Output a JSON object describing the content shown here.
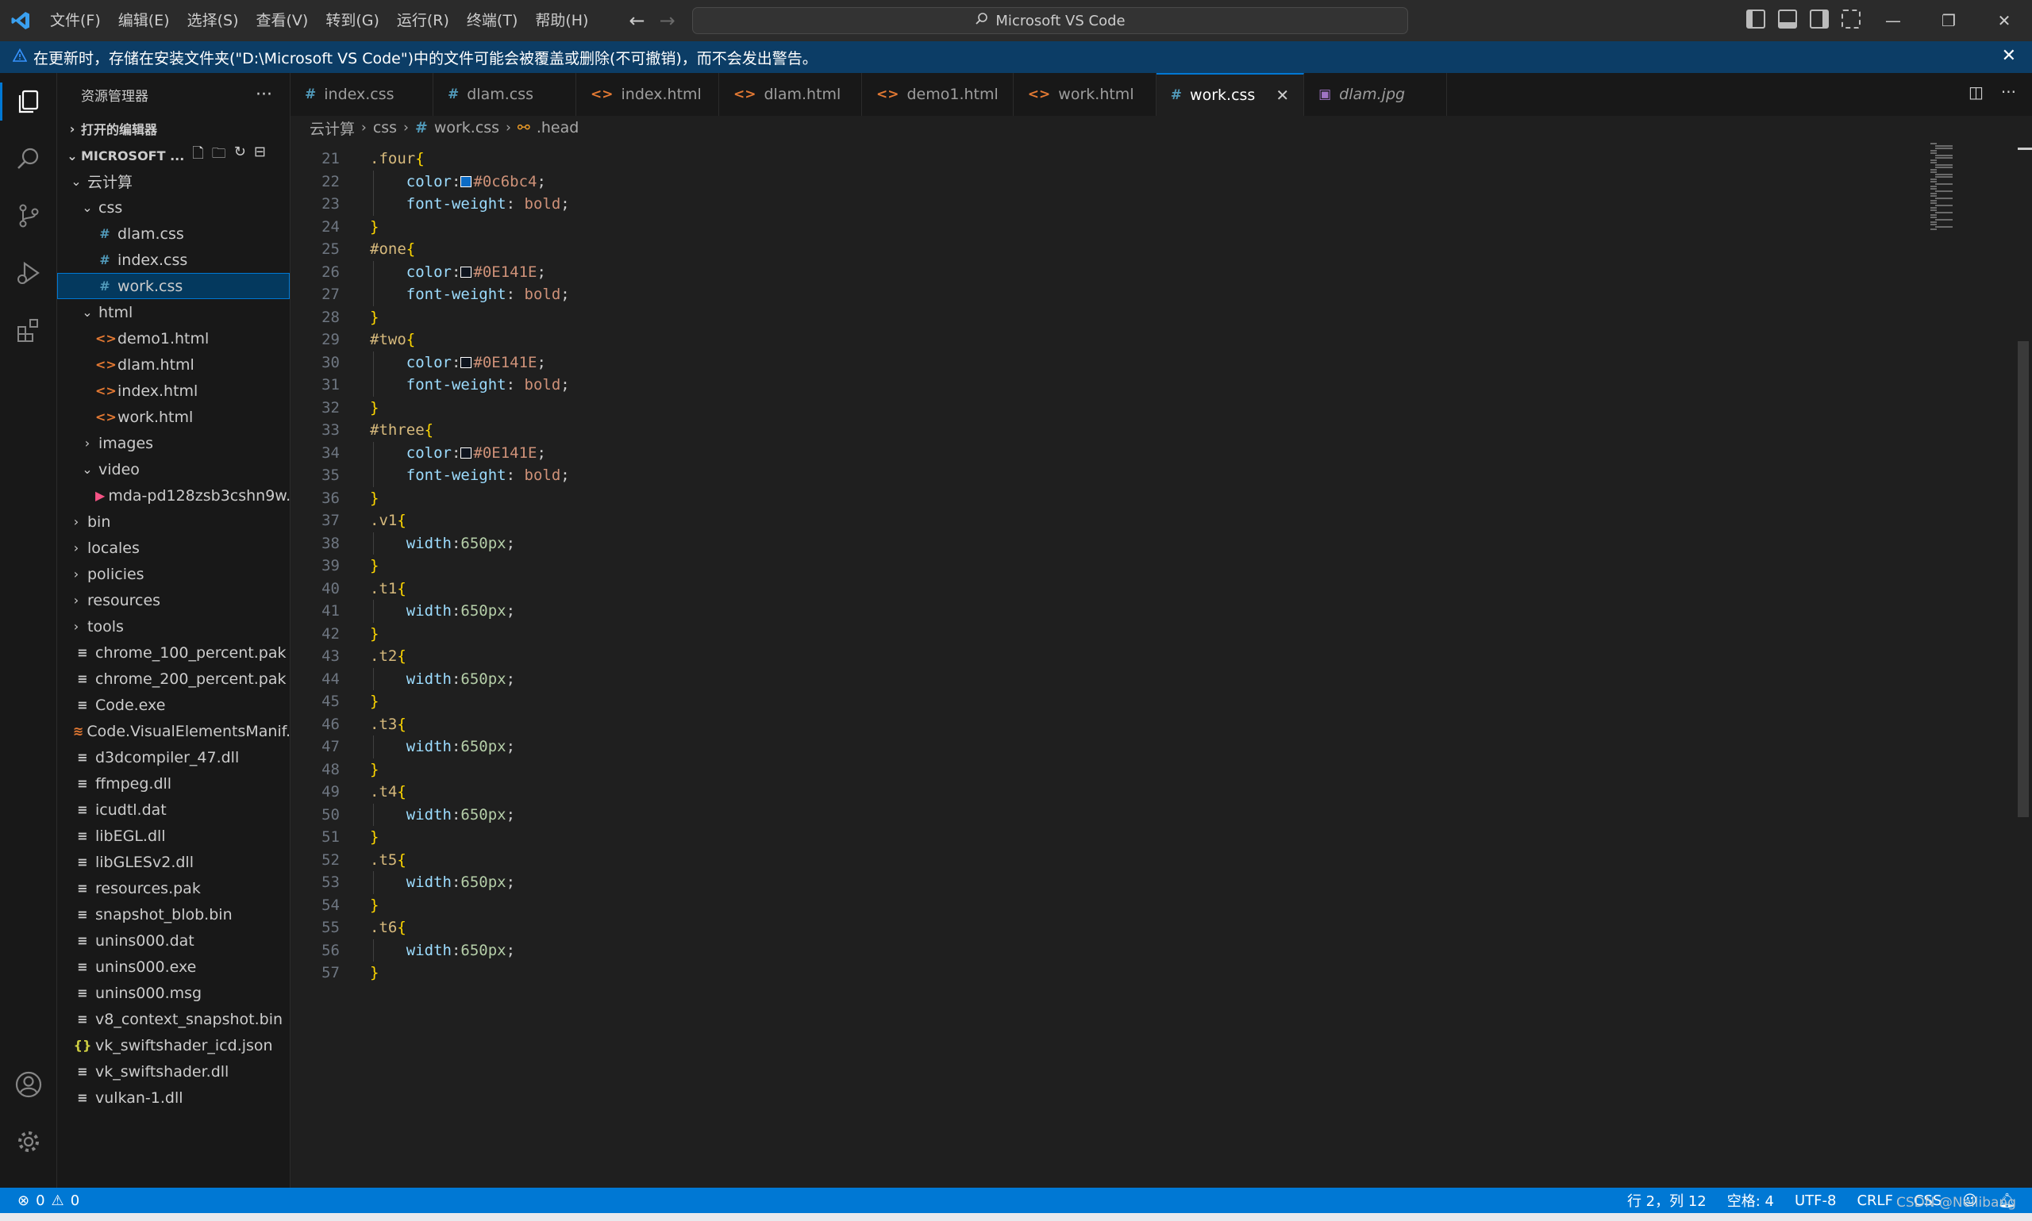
{
  "titlebar": {
    "menu": [
      "文件(F)",
      "编辑(E)",
      "选择(S)",
      "查看(V)",
      "转到(G)",
      "运行(R)",
      "终端(T)",
      "帮助(H)"
    ],
    "search_text": "Microsoft VS Code"
  },
  "banner": {
    "text": "在更新时，存储在安装文件夹(\"D:\\Microsoft VS Code\")中的文件可能会被覆盖或删除(不可撤销)，而不会发出警告。"
  },
  "sidebar": {
    "title": "资源管理器",
    "open_editors_label": "打开的编辑器",
    "folder_label": "MICROSOFT ...",
    "tree": [
      {
        "label": "云计算",
        "type": "folder-open",
        "depth": 1
      },
      {
        "label": "css",
        "type": "folder-open",
        "depth": 2
      },
      {
        "label": "dlam.css",
        "type": "css",
        "depth": 3
      },
      {
        "label": "index.css",
        "type": "css",
        "depth": 3
      },
      {
        "label": "work.css",
        "type": "css",
        "depth": 3,
        "selected": true
      },
      {
        "label": "html",
        "type": "folder-open",
        "depth": 2
      },
      {
        "label": "demo1.html",
        "type": "html",
        "depth": 3
      },
      {
        "label": "dlam.html",
        "type": "html",
        "depth": 3
      },
      {
        "label": "index.html",
        "type": "html",
        "depth": 3
      },
      {
        "label": "work.html",
        "type": "html",
        "depth": 3
      },
      {
        "label": "images",
        "type": "folder",
        "depth": 2
      },
      {
        "label": "video",
        "type": "folder-open",
        "depth": 2
      },
      {
        "label": "mda-pd128zsb3cshn9w...",
        "type": "video",
        "depth": 3
      },
      {
        "label": "bin",
        "type": "folder",
        "depth": 1
      },
      {
        "label": "locales",
        "type": "folder",
        "depth": 1
      },
      {
        "label": "policies",
        "type": "folder",
        "depth": 1
      },
      {
        "label": "resources",
        "type": "folder",
        "depth": 1
      },
      {
        "label": "tools",
        "type": "folder",
        "depth": 1
      },
      {
        "label": "chrome_100_percent.pak",
        "type": "file",
        "depth": 1
      },
      {
        "label": "chrome_200_percent.pak",
        "type": "file",
        "depth": 1
      },
      {
        "label": "Code.exe",
        "type": "file",
        "depth": 1
      },
      {
        "label": "Code.VisualElementsManif...",
        "type": "xml",
        "depth": 1
      },
      {
        "label": "d3dcompiler_47.dll",
        "type": "file",
        "depth": 1
      },
      {
        "label": "ffmpeg.dll",
        "type": "file",
        "depth": 1
      },
      {
        "label": "icudtl.dat",
        "type": "file",
        "depth": 1
      },
      {
        "label": "libEGL.dll",
        "type": "file",
        "depth": 1
      },
      {
        "label": "libGLESv2.dll",
        "type": "file",
        "depth": 1
      },
      {
        "label": "resources.pak",
        "type": "file",
        "depth": 1
      },
      {
        "label": "snapshot_blob.bin",
        "type": "file",
        "depth": 1
      },
      {
        "label": "unins000.dat",
        "type": "file",
        "depth": 1
      },
      {
        "label": "unins000.exe",
        "type": "file",
        "depth": 1
      },
      {
        "label": "unins000.msg",
        "type": "file",
        "depth": 1
      },
      {
        "label": "v8_context_snapshot.bin",
        "type": "file",
        "depth": 1
      },
      {
        "label": "vk_swiftshader_icd.json",
        "type": "json",
        "depth": 1
      },
      {
        "label": "vk_swiftshader.dll",
        "type": "file",
        "depth": 1
      },
      {
        "label": "vulkan-1.dll",
        "type": "file",
        "depth": 1
      }
    ]
  },
  "tabs": [
    {
      "label": "index.css",
      "type": "css"
    },
    {
      "label": "dlam.css",
      "type": "css"
    },
    {
      "label": "index.html",
      "type": "html"
    },
    {
      "label": "dlam.html",
      "type": "html"
    },
    {
      "label": "demo1.html",
      "type": "html"
    },
    {
      "label": "work.html",
      "type": "html"
    },
    {
      "label": "work.css",
      "type": "css",
      "active": true
    },
    {
      "label": "dlam.jpg",
      "type": "image",
      "preview": true
    }
  ],
  "breadcrumb": [
    "云计算",
    "css",
    "work.css",
    ".head"
  ],
  "code": [
    {
      "n": "21",
      "tokens": [
        [
          "sel",
          ".four"
        ],
        [
          "brace",
          "{"
        ]
      ]
    },
    {
      "n": "22",
      "tokens": [
        [
          "ws",
          "    "
        ],
        [
          "prop",
          "color"
        ],
        [
          "punc",
          ":"
        ],
        [
          "swatch",
          "#0c6bc4"
        ],
        [
          "val",
          "#0c6bc4"
        ],
        [
          "punc",
          ";"
        ]
      ]
    },
    {
      "n": "23",
      "tokens": [
        [
          "ws",
          "    "
        ],
        [
          "prop",
          "font-weight"
        ],
        [
          "punc",
          ": "
        ],
        [
          "val",
          "bold"
        ],
        [
          "punc",
          ";"
        ]
      ]
    },
    {
      "n": "24",
      "tokens": [
        [
          "brace",
          "}"
        ]
      ]
    },
    {
      "n": "25",
      "tokens": [
        [
          "sel",
          "#one"
        ],
        [
          "brace",
          "{"
        ]
      ]
    },
    {
      "n": "26",
      "tokens": [
        [
          "ws",
          "    "
        ],
        [
          "prop",
          "color"
        ],
        [
          "punc",
          ":"
        ],
        [
          "swatch",
          "#0E141E"
        ],
        [
          "val",
          "#0E141E"
        ],
        [
          "punc",
          ";"
        ]
      ]
    },
    {
      "n": "27",
      "tokens": [
        [
          "ws",
          "    "
        ],
        [
          "prop",
          "font-weight"
        ],
        [
          "punc",
          ": "
        ],
        [
          "val",
          "bold"
        ],
        [
          "punc",
          ";"
        ]
      ]
    },
    {
      "n": "28",
      "tokens": [
        [
          "brace",
          "}"
        ]
      ]
    },
    {
      "n": "29",
      "tokens": [
        [
          "sel",
          "#two"
        ],
        [
          "brace",
          "{"
        ]
      ]
    },
    {
      "n": "30",
      "tokens": [
        [
          "ws",
          "    "
        ],
        [
          "prop",
          "color"
        ],
        [
          "punc",
          ":"
        ],
        [
          "swatch",
          "#0E141E"
        ],
        [
          "val",
          "#0E141E"
        ],
        [
          "punc",
          ";"
        ]
      ]
    },
    {
      "n": "31",
      "tokens": [
        [
          "ws",
          "    "
        ],
        [
          "prop",
          "font-weight"
        ],
        [
          "punc",
          ": "
        ],
        [
          "val",
          "bold"
        ],
        [
          "punc",
          ";"
        ]
      ]
    },
    {
      "n": "32",
      "tokens": [
        [
          "brace",
          "}"
        ]
      ]
    },
    {
      "n": "33",
      "tokens": [
        [
          "sel",
          "#three"
        ],
        [
          "brace",
          "{"
        ]
      ]
    },
    {
      "n": "34",
      "tokens": [
        [
          "ws",
          "    "
        ],
        [
          "prop",
          "color"
        ],
        [
          "punc",
          ":"
        ],
        [
          "swatch",
          "#0E141E"
        ],
        [
          "val",
          "#0E141E"
        ],
        [
          "punc",
          ";"
        ]
      ]
    },
    {
      "n": "35",
      "tokens": [
        [
          "ws",
          "    "
        ],
        [
          "prop",
          "font-weight"
        ],
        [
          "punc",
          ": "
        ],
        [
          "val",
          "bold"
        ],
        [
          "punc",
          ";"
        ]
      ]
    },
    {
      "n": "36",
      "tokens": [
        [
          "brace",
          "}"
        ]
      ]
    },
    {
      "n": "37",
      "tokens": [
        [
          "sel",
          ".v1"
        ],
        [
          "brace",
          "{"
        ]
      ]
    },
    {
      "n": "38",
      "tokens": [
        [
          "ws",
          "    "
        ],
        [
          "prop",
          "width"
        ],
        [
          "punc",
          ":"
        ],
        [
          "num",
          "650px"
        ],
        [
          "punc",
          ";"
        ]
      ]
    },
    {
      "n": "39",
      "tokens": [
        [
          "brace",
          "}"
        ]
      ]
    },
    {
      "n": "40",
      "tokens": [
        [
          "sel",
          ".t1"
        ],
        [
          "brace",
          "{"
        ]
      ]
    },
    {
      "n": "41",
      "tokens": [
        [
          "ws",
          "    "
        ],
        [
          "prop",
          "width"
        ],
        [
          "punc",
          ":"
        ],
        [
          "num",
          "650px"
        ],
        [
          "punc",
          ";"
        ]
      ]
    },
    {
      "n": "42",
      "tokens": [
        [
          "brace",
          "}"
        ]
      ]
    },
    {
      "n": "43",
      "tokens": [
        [
          "sel",
          ".t2"
        ],
        [
          "brace",
          "{"
        ]
      ]
    },
    {
      "n": "44",
      "tokens": [
        [
          "ws",
          "    "
        ],
        [
          "prop",
          "width"
        ],
        [
          "punc",
          ":"
        ],
        [
          "num",
          "650px"
        ],
        [
          "punc",
          ";"
        ]
      ]
    },
    {
      "n": "45",
      "tokens": [
        [
          "brace",
          "}"
        ]
      ]
    },
    {
      "n": "46",
      "tokens": [
        [
          "sel",
          ".t3"
        ],
        [
          "brace",
          "{"
        ]
      ]
    },
    {
      "n": "47",
      "tokens": [
        [
          "ws",
          "    "
        ],
        [
          "prop",
          "width"
        ],
        [
          "punc",
          ":"
        ],
        [
          "num",
          "650px"
        ],
        [
          "punc",
          ";"
        ]
      ]
    },
    {
      "n": "48",
      "tokens": [
        [
          "brace",
          "}"
        ]
      ]
    },
    {
      "n": "49",
      "tokens": [
        [
          "sel",
          ".t4"
        ],
        [
          "brace",
          "{"
        ]
      ]
    },
    {
      "n": "50",
      "tokens": [
        [
          "ws",
          "    "
        ],
        [
          "prop",
          "width"
        ],
        [
          "punc",
          ":"
        ],
        [
          "num",
          "650px"
        ],
        [
          "punc",
          ";"
        ]
      ]
    },
    {
      "n": "51",
      "tokens": [
        [
          "brace",
          "}"
        ]
      ]
    },
    {
      "n": "52",
      "tokens": [
        [
          "sel",
          ".t5"
        ],
        [
          "brace",
          "{"
        ]
      ]
    },
    {
      "n": "53",
      "tokens": [
        [
          "ws",
          "    "
        ],
        [
          "prop",
          "width"
        ],
        [
          "punc",
          ":"
        ],
        [
          "num",
          "650px"
        ],
        [
          "punc",
          ";"
        ]
      ]
    },
    {
      "n": "54",
      "tokens": [
        [
          "brace",
          "}"
        ]
      ]
    },
    {
      "n": "55",
      "tokens": [
        [
          "sel",
          ".t6"
        ],
        [
          "brace",
          "{"
        ]
      ]
    },
    {
      "n": "56",
      "tokens": [
        [
          "ws",
          "    "
        ],
        [
          "prop",
          "width"
        ],
        [
          "punc",
          ":"
        ],
        [
          "num",
          "650px"
        ],
        [
          "punc",
          ";"
        ]
      ]
    },
    {
      "n": "57",
      "tokens": [
        [
          "brace",
          "}"
        ]
      ]
    }
  ],
  "statusbar": {
    "errors": "0",
    "warnings": "0",
    "position": "行 2，列 12",
    "spaces": "空格: 4",
    "encoding": "UTF-8",
    "eol": "CRLF",
    "language": "CSS"
  },
  "watermark": "CSDN @Neilibang"
}
